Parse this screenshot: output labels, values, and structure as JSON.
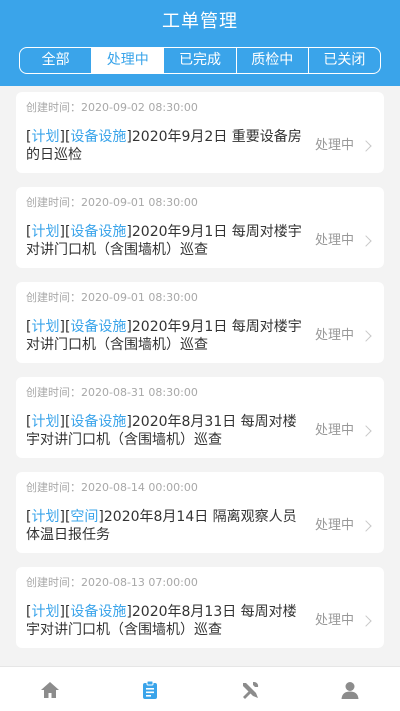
{
  "header": {
    "title": "工单管理"
  },
  "tabs": [
    "全部",
    "处理中",
    "已完成",
    "质检中",
    "已关闭"
  ],
  "orders": [
    {
      "time": "创建时间：2020-09-02 08:30:00",
      "tags": [
        "计划",
        "设备设施"
      ],
      "title": "2020年9月2日 重要设备房的日巡检",
      "status": "处理中"
    },
    {
      "time": "创建时间：2020-09-01 08:30:00",
      "tags": [
        "计划",
        "设备设施"
      ],
      "title": "2020年9月1日 每周对楼宇对讲门口机（含围墙机）巡查",
      "status": "处理中"
    },
    {
      "time": "创建时间：2020-09-01 08:30:00",
      "tags": [
        "计划",
        "设备设施"
      ],
      "title": "2020年9月1日 每周对楼宇对讲门口机（含围墙机）巡查",
      "status": "处理中"
    },
    {
      "time": "创建时间：2020-08-31 08:30:00",
      "tags": [
        "计划",
        "设备设施"
      ],
      "title": "2020年8月31日 每周对楼宇对讲门口机（含围墙机）巡查",
      "status": "处理中"
    },
    {
      "time": "创建时间：2020-08-14 00:00:00",
      "tags": [
        "计划",
        "空间"
      ],
      "title": "2020年8月14日 隔离观察人员体温日报任务",
      "status": "处理中"
    },
    {
      "time": "创建时间：2020-08-13 07:00:00",
      "tags": [
        "计划",
        "设备设施"
      ],
      "title": "2020年8月13日 每周对楼宇对讲门口机（含围墙机）巡查",
      "status": "处理中"
    }
  ],
  "tabbar": {
    "icons": [
      "home-icon",
      "clipboard-icon",
      "tools-icon",
      "user-icon"
    ],
    "active_color": "#3aa4ea",
    "inactive_color": "#8c8c8c"
  },
  "colors": {
    "accent": "#3aa4ea",
    "background": "#f3f3f3"
  }
}
